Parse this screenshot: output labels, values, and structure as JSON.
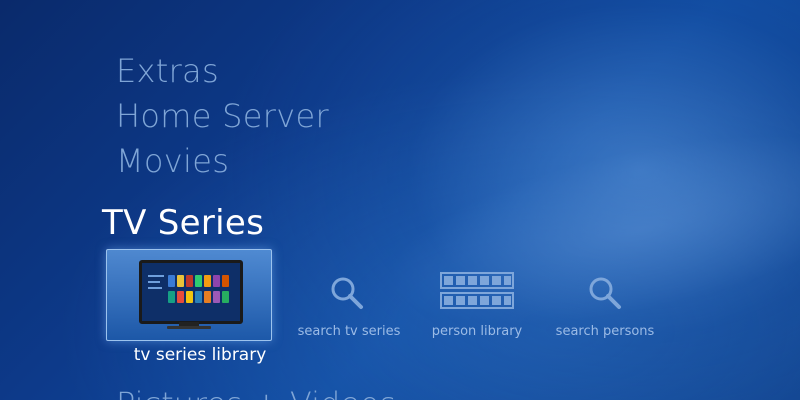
{
  "menu": {
    "items": [
      "Extras",
      "Home Server",
      "Movies"
    ],
    "next_item": "Pictures + Videos"
  },
  "section": {
    "title": "TV Series"
  },
  "tiles": [
    {
      "label": "tv series library",
      "selected": true,
      "icon": "tv-icon"
    },
    {
      "label": "search tv series",
      "selected": false,
      "icon": "search-icon"
    },
    {
      "label": "person library",
      "selected": false,
      "icon": "film-grid-icon"
    },
    {
      "label": "search persons",
      "selected": false,
      "icon": "search-icon"
    }
  ],
  "colors": {
    "background": "#0d3a8a",
    "menu_text": "#7fa5d6",
    "selected_text": "#ffffff",
    "tile_label": "#9bbbe6"
  }
}
